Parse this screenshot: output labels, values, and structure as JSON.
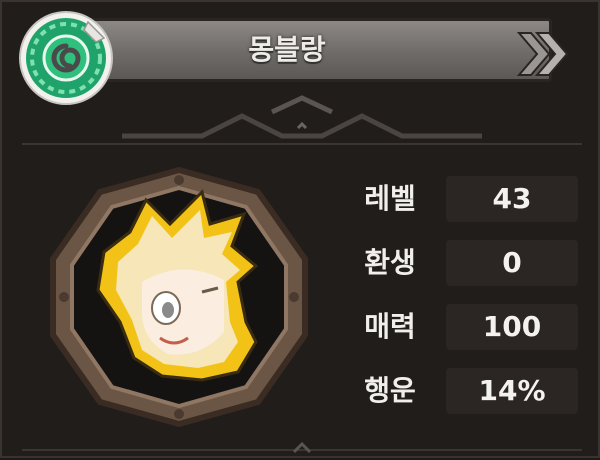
{
  "header": {
    "title": "몽블랑",
    "next_icon": "double-chevron-right-icon",
    "emblem_icon": "green-swirl-emblem-icon"
  },
  "portrait": {
    "icon": "blonde-character-portrait"
  },
  "stats": [
    {
      "label": "레벨",
      "value": "43"
    },
    {
      "label": "환생",
      "value": "0"
    },
    {
      "label": "매력",
      "value": "100"
    },
    {
      "label": "행운",
      "value": "14%"
    }
  ],
  "colors": {
    "panel_bg": "#211d1b",
    "header_grey": "#7a7674",
    "emblem_green": "#1fa36a",
    "frame_bronze": "#7a6553",
    "portrait_gold": "#f2c316"
  }
}
